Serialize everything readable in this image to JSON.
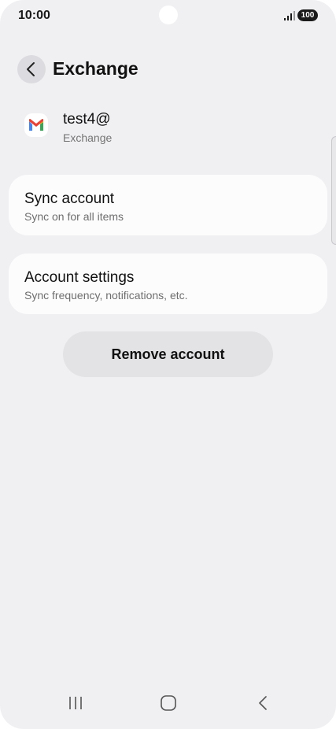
{
  "status_bar": {
    "time": "10:00",
    "battery": "100",
    "icons": [
      "camera-cutout",
      "signal-icon",
      "battery-icon"
    ]
  },
  "header": {
    "title": "Exchange",
    "back_icon": "chevron-left-icon"
  },
  "account": {
    "name": "test4@",
    "type": "Exchange",
    "icon": "gmail-icon"
  },
  "cards": [
    {
      "title": "Sync account",
      "subtitle": "Sync on for all items"
    },
    {
      "title": "Account settings",
      "subtitle": "Sync frequency, notifications, etc."
    }
  ],
  "remove_button": {
    "label": "Remove account"
  },
  "nav_bar": {
    "icons": [
      "recent-apps-icon",
      "home-icon",
      "back-icon"
    ]
  },
  "colors": {
    "background": "#f0f0f3",
    "card": "#fcfcfd",
    "button": "#e3e3e6",
    "gmail_red": "#EA4335",
    "gmail_blue": "#4285F4",
    "gmail_green": "#34A853",
    "gmail_yellow": "#FBBC04"
  }
}
